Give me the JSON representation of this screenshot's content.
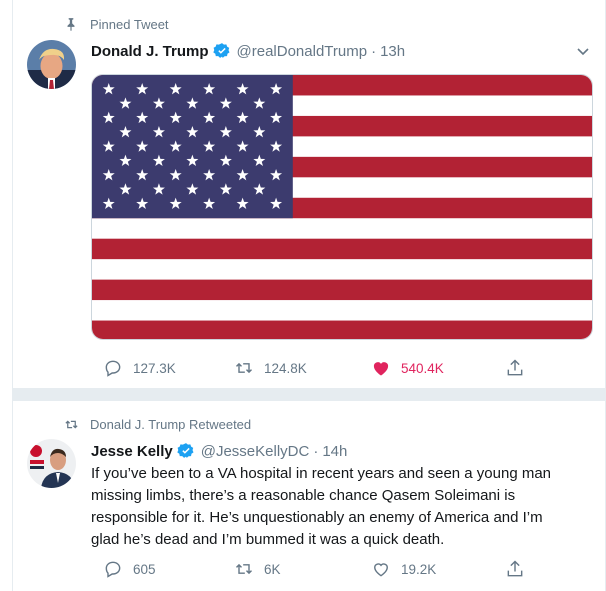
{
  "tweets": [
    {
      "context_label": "Pinned Tweet",
      "name": "Donald J. Trump",
      "handle": "@realDonaldTrump",
      "separator": "·",
      "time": "13h",
      "actions": {
        "replies": "127.3K",
        "retweets": "124.8K",
        "likes": "540.4K"
      },
      "liked": true,
      "media": "american-flag"
    },
    {
      "context_label": "Donald J. Trump Retweeted",
      "name": "Jesse Kelly",
      "handle": "@JesseKellyDC",
      "separator": "·",
      "time": "14h",
      "text_lines": [
        "If you’ve been to a VA hospital in recent years and seen a young man",
        "missing limbs, there’s a reasonable chance Qasem Soleimani is",
        "responsible for it. He’s unquestionably an enemy of America and I’m",
        "glad he’s dead and I’m bummed it was a quick death."
      ],
      "actions": {
        "replies": "605",
        "retweets": "6K",
        "likes": "19.2K"
      },
      "liked": false
    }
  ],
  "colors": {
    "accent": "#1da1f2",
    "like": "#e0245e",
    "muted": "#657786",
    "flag_red": "#b22234",
    "flag_blue": "#3c3b6e"
  }
}
